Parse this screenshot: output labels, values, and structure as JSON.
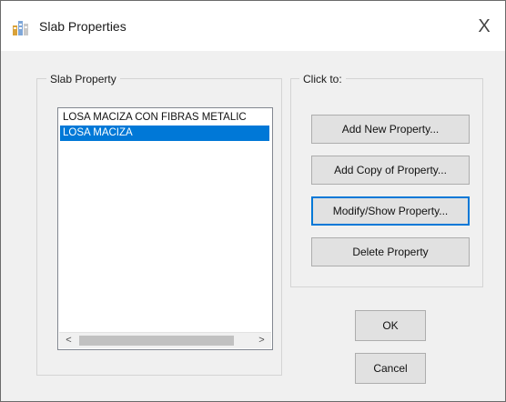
{
  "window": {
    "title": "Slab Properties",
    "close_glyph": "X"
  },
  "slab_group": {
    "label": "Slab Property",
    "items": [
      {
        "label": "LOSA MACIZA CON FIBRAS METALIC",
        "selected": false
      },
      {
        "label": "LOSA MACIZA",
        "selected": true
      }
    ],
    "scroll_left": "<",
    "scroll_right": ">"
  },
  "click_group": {
    "label": "Click to:",
    "add_new": "Add New Property...",
    "add_copy": "Add Copy of Property...",
    "modify": "Modify/Show Property...",
    "delete": "Delete Property"
  },
  "buttons": {
    "ok": "OK",
    "cancel": "Cancel"
  },
  "colors": {
    "selection": "#0078d7",
    "focus_border": "#0078d7"
  },
  "icons": {
    "app": "slab-properties-icon"
  }
}
